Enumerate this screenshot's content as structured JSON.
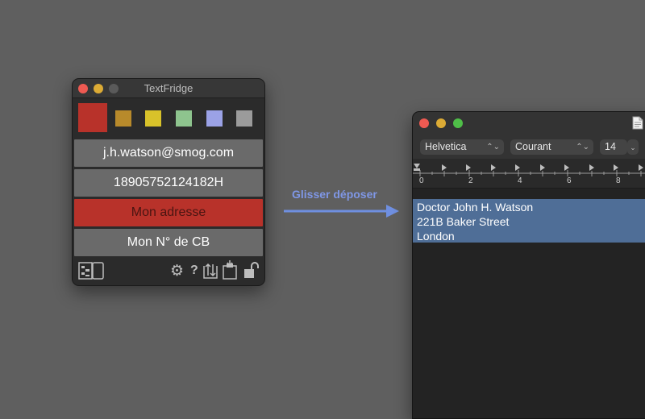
{
  "textfridge": {
    "title": "TextFridge",
    "swatch_colors": [
      "#b8322a",
      "#b88a2b",
      "#d8c22a",
      "#8ec48e",
      "#9ba2e6",
      "#9b9b9b"
    ],
    "items": [
      {
        "label": "j.h.watson@smog.com",
        "color": "#6a6a6a"
      },
      {
        "label": "18905752124182H",
        "color": "#6a6a6a"
      },
      {
        "label": "Mon adresse",
        "color": "#b8322a"
      },
      {
        "label": "Mon N° de CB",
        "color": "#6a6a6a"
      }
    ],
    "toolbar": {
      "icons": [
        "split-view-icon",
        "gear-icon",
        "help-icon",
        "sort-icon",
        "paste-icon",
        "unlock-icon"
      ],
      "help_glyph": "?"
    }
  },
  "drag": {
    "label": "Glisser déposer",
    "arrow_color": "#6f8fe0"
  },
  "textedit": {
    "font": "Helvetica",
    "style": "Courant",
    "size": "14",
    "ruler_numbers": [
      "0",
      "2",
      "4",
      "6",
      "8"
    ],
    "lines": [
      "Doctor John H. Watson",
      "221B Baker Street",
      "London"
    ],
    "selection_color": "#4f6e97"
  }
}
